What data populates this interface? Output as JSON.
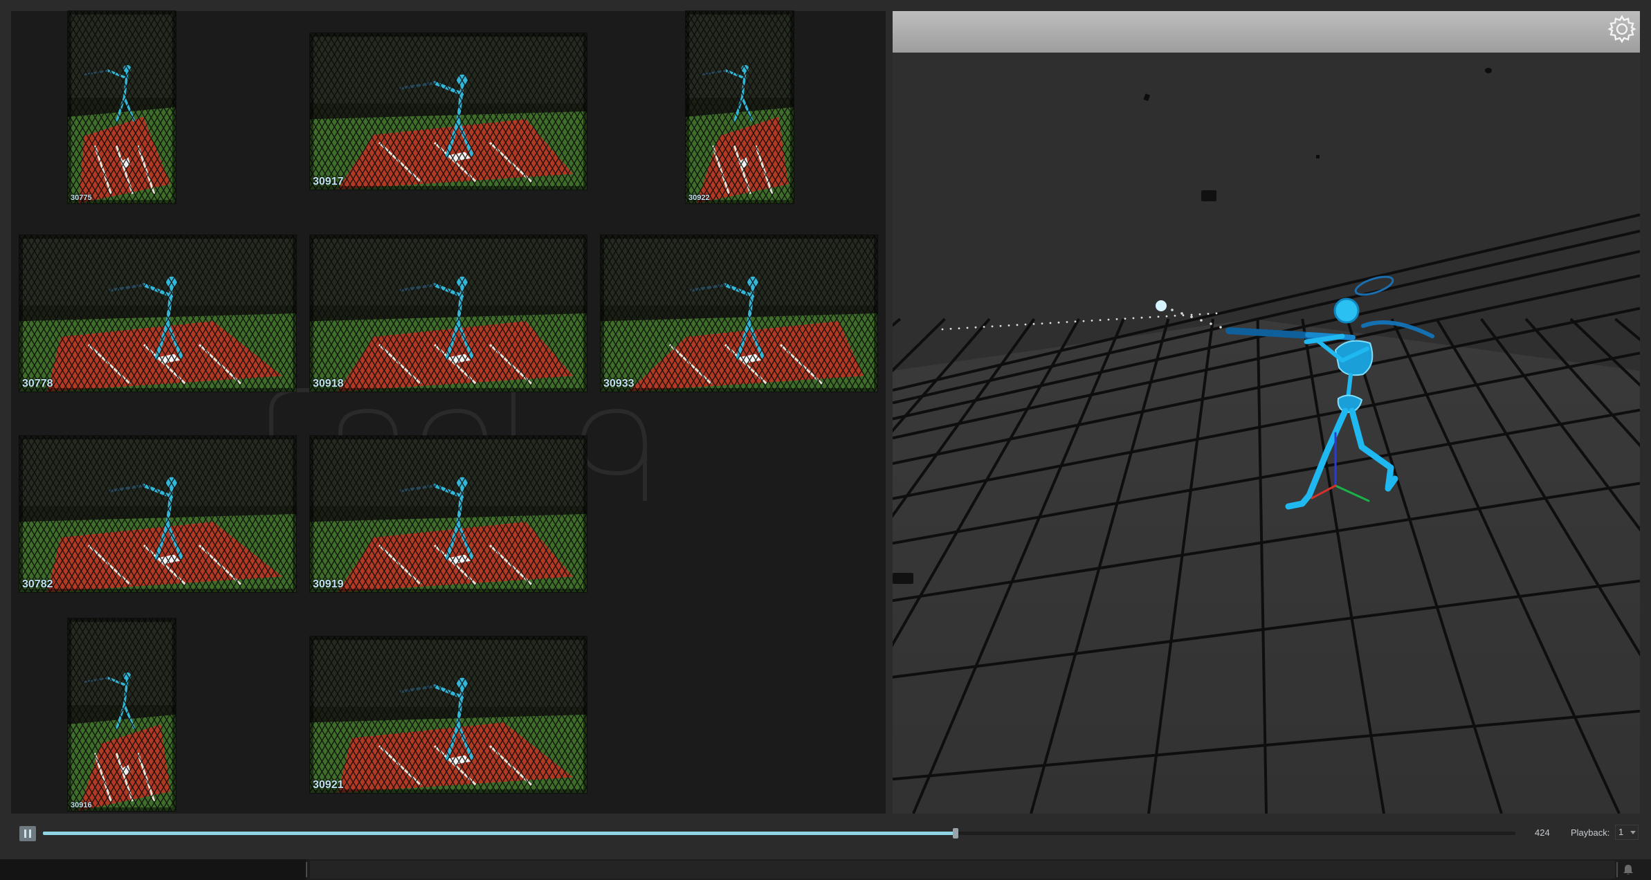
{
  "cameras": [
    {
      "id": "30775",
      "label": "30775"
    },
    {
      "id": "30917",
      "label": "30917"
    },
    {
      "id": "30922",
      "label": "30922"
    },
    {
      "id": "30778",
      "label": "30778"
    },
    {
      "id": "30918",
      "label": "30918"
    },
    {
      "id": "30933",
      "label": "30933"
    },
    {
      "id": "30782",
      "label": "30782"
    },
    {
      "id": "30919",
      "label": "30919"
    },
    {
      "id": "30916",
      "label": "30916"
    },
    {
      "id": "30921",
      "label": "30921"
    }
  ],
  "viewport": {
    "settings_icon": "gear-icon",
    "background": "#2e2e2e",
    "skeleton_color": "#1fb8f0"
  },
  "playback": {
    "control_icon": "pause-icon",
    "progress": 0.62,
    "frame": "424",
    "speed_label": "Playback:",
    "speed_value": "1"
  },
  "colors": {
    "accent": "#8fd5e6",
    "skeleton": "#1fb8f0",
    "net": "#0a0a0a",
    "turf": "#3f6d2a",
    "clay": "#b23a24"
  }
}
